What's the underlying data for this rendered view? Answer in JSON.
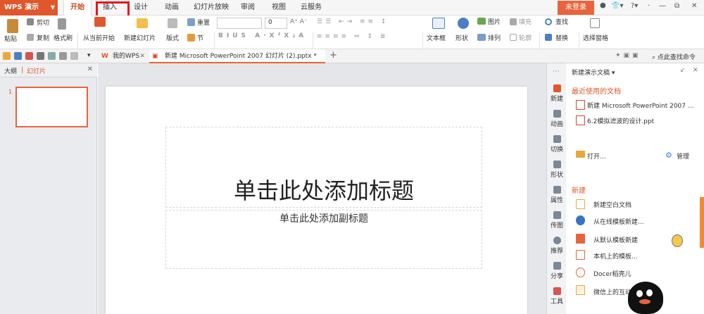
{
  "app": {
    "name": "WPS 演示"
  },
  "menu_tabs": [
    "开始",
    "插入",
    "设计",
    "动画",
    "幻灯片放映",
    "审阅",
    "视图",
    "云服务"
  ],
  "login_label": "未登录",
  "ribbon": {
    "paste": "粘贴",
    "cut": "剪切",
    "copy": "复制",
    "format_painter": "格式刷",
    "from_current": "从当前开始",
    "new_slide": "新建幻灯片",
    "layout": "版式",
    "section": "节",
    "reset": "重置",
    "font_size": "0",
    "textbox": "文本框",
    "shape": "形状",
    "picture": "图片",
    "fill": "填充",
    "arrange": "排列",
    "outline": "轮廓",
    "find": "查找",
    "replace": "替换",
    "selection_pane": "选择窗格"
  },
  "doc_tabs": {
    "wps": "我的WPS",
    "file": "新建 Microsoft PowerPoint 2007 幻灯片 (2).pptx *",
    "search": "点此查找命令"
  },
  "left_panel": {
    "outline": "大纲",
    "slides": "幻灯片",
    "slide_number": "1"
  },
  "slide": {
    "title": "单击此处添加标题",
    "subtitle": "单击此处添加副标题"
  },
  "right_strip": [
    "新建",
    "动画",
    "切换",
    "形状",
    "属性",
    "传图",
    "推荐",
    "分享",
    "工具"
  ],
  "task_pane": {
    "header": "新建演示文稿",
    "recent_heading": "最近使用的文档",
    "recent": [
      "新建 Microsoft PowerPoint 2007 ...",
      "6.2模拟滤波的设计.ppt"
    ],
    "open": "打开...",
    "manage": "管理",
    "new_heading": "新建",
    "new_items": [
      "新建空白文档",
      "从在线模板新建...",
      "从默认模板新建",
      "本机上的模板...",
      "Docer稻壳儿",
      "微信上的互动..."
    ]
  },
  "colors": {
    "accent": "#e0572b",
    "highlight": "#e8141a"
  }
}
